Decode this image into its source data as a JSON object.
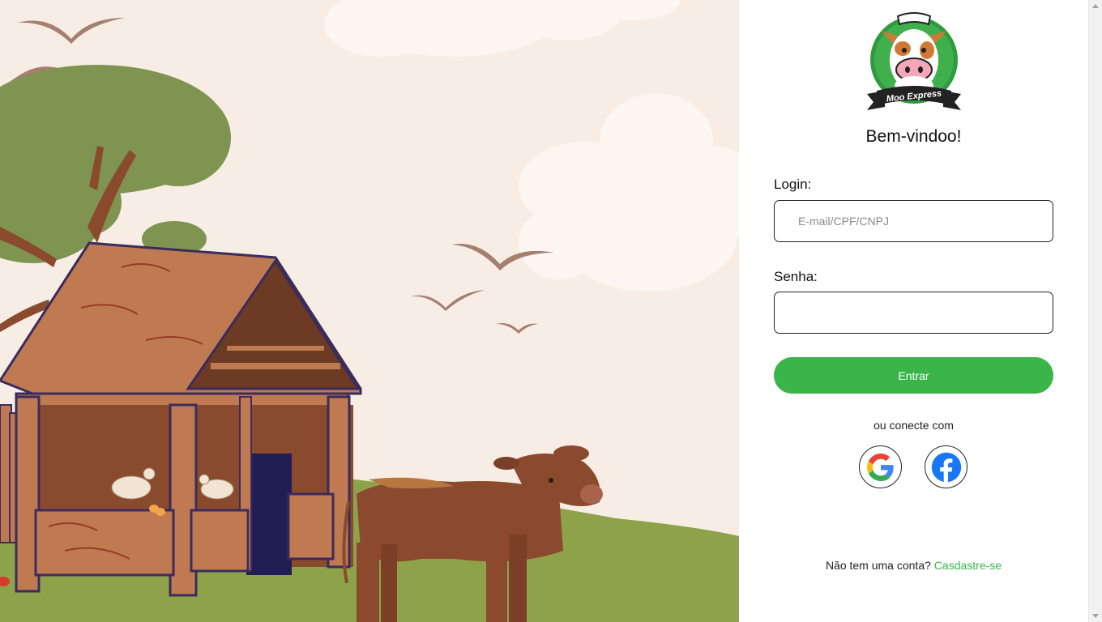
{
  "login_form": {
    "welcome_title": "Bem-vindoo!",
    "login_label": "Login:",
    "login_placeholder": "E-mail/CPF/CNPJ",
    "login_value": "",
    "password_label": "Senha:",
    "password_value": "",
    "submit_label": "Entrar",
    "alt_connect_text": "ou conecte com",
    "social_providers": [
      {
        "name": "Google",
        "icon": "google-icon"
      },
      {
        "name": "Facebook",
        "icon": "facebook-icon"
      }
    ],
    "signup_prompt": "Não tem uma conta?",
    "signup_link": "Casdastre-se"
  },
  "logo": {
    "text": "Moo Express"
  },
  "colors": {
    "accent": "#3ab54a",
    "sky": "#f7ede4",
    "grass": "#8ea24a",
    "tree_foliage": "#7e9450",
    "barn": "#c07a52",
    "cow": "#8b4a2f"
  }
}
